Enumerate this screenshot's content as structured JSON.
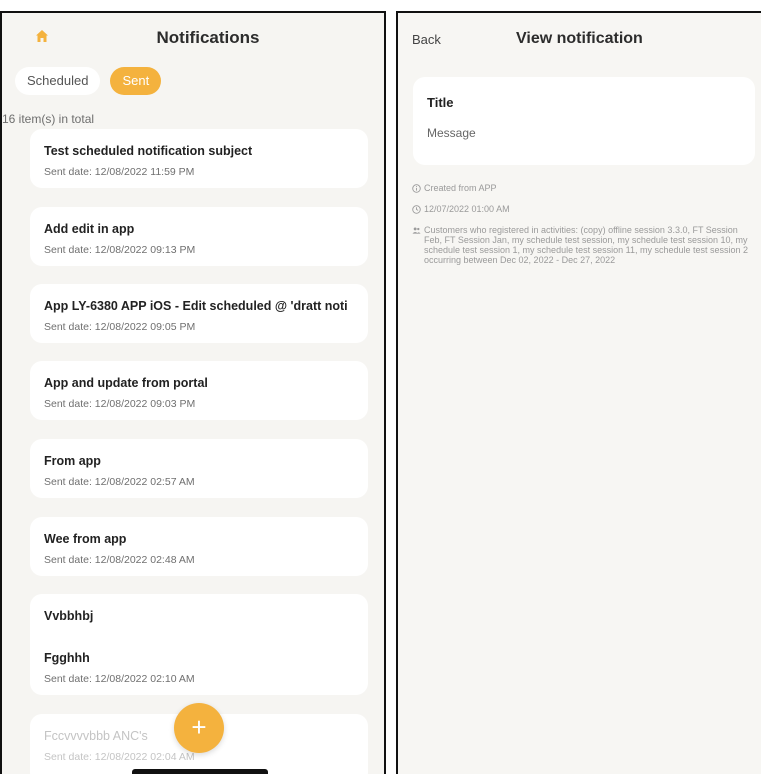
{
  "colors": {
    "accent": "#f4b23e",
    "background": "#f6f5f2"
  },
  "left": {
    "title": "Notifications",
    "tabs": [
      {
        "label": "Scheduled",
        "active": false
      },
      {
        "label": "Sent",
        "active": true
      }
    ],
    "total_label": "16 item(s) in total",
    "fab_label": "+",
    "items": [
      {
        "title": "Test scheduled notification subject",
        "date": "Sent date: 12/08/2022 11:59 PM"
      },
      {
        "title": "Add edit in app",
        "date": "Sent date: 12/08/2022 09:13 PM"
      },
      {
        "title": "App LY-6380 APP iOS - Edit scheduled @ 'dratt noti",
        "date": "Sent date: 12/08/2022 09:05 PM"
      },
      {
        "title": "App and update from portal",
        "date": "Sent date: 12/08/2022 09:03 PM"
      },
      {
        "title": "From app",
        "date": "Sent date: 12/08/2022 02:57 AM"
      },
      {
        "title": "Wee from app",
        "date": "Sent date: 12/08/2022 02:48 AM"
      },
      {
        "title": "Vvbbhbj",
        "subtitle": "Fgghhh",
        "date": "Sent date: 12/08/2022 02:10 AM"
      },
      {
        "title": "Fccvvvvbbb ANC's",
        "date": "Sent date: 12/08/2022 02:04 AM"
      }
    ]
  },
  "right": {
    "back_label": "Back",
    "title": "View notification",
    "card": {
      "title": "Title",
      "message": "Message"
    },
    "meta": {
      "created_from": "Created from APP",
      "datetime": "12/07/2022 01:00 AM",
      "audience": "Customers who registered in activities: (copy) offline session 3.3.0, FT Session Feb, FT Session Jan, my schedule test session, my schedule test session 10, my schedule test session 1, my schedule test session 11, my schedule test session 2 occurring between Dec 02, 2022 - Dec 27, 2022"
    }
  }
}
